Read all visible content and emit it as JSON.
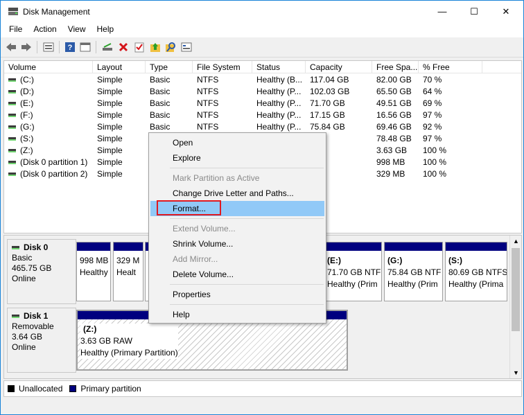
{
  "window": {
    "title": "Disk Management",
    "minimize": "—",
    "maximize": "☐",
    "close": "✕"
  },
  "menu": [
    "File",
    "Action",
    "View",
    "Help"
  ],
  "toolbar_icons": [
    "back-icon",
    "forward-icon",
    "disk-list-icon",
    "help-icon",
    "properties-icon",
    "connect-icon",
    "delete-icon",
    "check-icon",
    "folder-up-icon",
    "search-icon",
    "settings-icon"
  ],
  "list": {
    "columns": [
      "Volume",
      "Layout",
      "Type",
      "File System",
      "Status",
      "Capacity",
      "Free Spa...",
      "% Free"
    ],
    "rows": [
      [
        "(C:)",
        "Simple",
        "Basic",
        "NTFS",
        "Healthy (B...",
        "117.04 GB",
        "82.00 GB",
        "70 %"
      ],
      [
        "(D:)",
        "Simple",
        "Basic",
        "NTFS",
        "Healthy (P...",
        "102.03 GB",
        "65.50 GB",
        "64 %"
      ],
      [
        "(E:)",
        "Simple",
        "Basic",
        "NTFS",
        "Healthy (P...",
        "71.70 GB",
        "49.51 GB",
        "69 %"
      ],
      [
        "(F:)",
        "Simple",
        "Basic",
        "NTFS",
        "Healthy (P...",
        "17.15 GB",
        "16.56 GB",
        "97 %"
      ],
      [
        "(G:)",
        "Simple",
        "Basic",
        "NTFS",
        "Healthy (P...",
        "75.84 GB",
        "69.46 GB",
        "92 %"
      ],
      [
        "(S:)",
        "Simple",
        "",
        "",
        "",
        "",
        "78.48 GB",
        "97 %"
      ],
      [
        "(Z:)",
        "Simple",
        "",
        "",
        "",
        "GB",
        "3.63 GB",
        "100 %"
      ],
      [
        "(Disk 0 partition 1)",
        "Simple",
        "",
        "",
        "",
        "MB",
        "998 MB",
        "100 %"
      ],
      [
        "(Disk 0 partition 2)",
        "Simple",
        "",
        "",
        "",
        "MB",
        "329 MB",
        "100 %"
      ]
    ]
  },
  "disks": [
    {
      "name": "Disk 0",
      "type": "Basic",
      "size": "465.75 GB",
      "state": "Online",
      "partitions": [
        {
          "l1": "998 MB",
          "l2": "Healthy"
        },
        {
          "l1": "329 M",
          "l2": "Healt"
        },
        {
          "l1": "",
          "l2": ""
        },
        {
          "l1": "",
          "l2": ""
        },
        {
          "name": "(E:)",
          "l1": "71.70 GB NTF",
          "l2": "Healthy (Prim"
        },
        {
          "name": "(G:)",
          "l1": "75.84 GB NTF",
          "l2": "Healthy (Prim"
        },
        {
          "name": "(S:)",
          "l1": "80.69 GB NTFS",
          "l2": "Healthy (Prima"
        }
      ]
    },
    {
      "name": "Disk 1",
      "type": "Removable",
      "size": "3.64 GB",
      "state": "Online",
      "partitions": [
        {
          "name": "(Z:)",
          "l1": "3.63 GB RAW",
          "l2": "Healthy (Primary Partition)"
        }
      ]
    }
  ],
  "legend": {
    "unallocated": "Unallocated",
    "primary": "Primary partition"
  },
  "colors": {
    "primary_partition": "#00007f",
    "unallocated": "#000000",
    "highlight": "#91c9f7",
    "callout_border": "#e0181f"
  },
  "context_menu": [
    {
      "label": "Open",
      "enabled": true
    },
    {
      "label": "Explore",
      "enabled": true
    },
    {
      "label": "Mark Partition as Active",
      "enabled": false
    },
    {
      "label": "Change Drive Letter and Paths...",
      "enabled": true
    },
    {
      "label": "Format...",
      "enabled": true,
      "highlighted": true
    },
    {
      "label": "Extend Volume...",
      "enabled": false
    },
    {
      "label": "Shrink Volume...",
      "enabled": true
    },
    {
      "label": "Add Mirror...",
      "enabled": false
    },
    {
      "label": "Delete Volume...",
      "enabled": true
    },
    {
      "label": "Properties",
      "enabled": true
    },
    {
      "label": "Help",
      "enabled": true
    }
  ]
}
